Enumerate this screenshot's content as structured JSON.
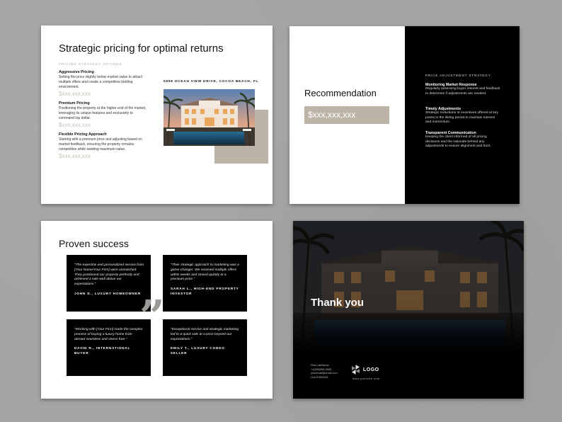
{
  "slide1": {
    "title": "Strategic pricing for optimal returns",
    "label": "PRICING STRATEGY OPTIONS",
    "options": [
      {
        "heading": "Aggressive Pricing",
        "desc": "Setting the price slightly below market value to attract multiple offers and create a competitive bidding environment.",
        "price": "$xxx,xxx,xxx"
      },
      {
        "heading": "Premium Pricing",
        "desc": "Positioning the property at the higher end of the market, leveraging its unique features and exclusivity to command top dollar.",
        "price": "$xxx,xxx,xxx"
      },
      {
        "heading": "Flexible Pricing Approach",
        "desc": "Starting with a premium price and adjusting based on market feedback, ensuring the property remains competitive while seeking maximum value.",
        "price": "$xxx,xxx,xxx"
      }
    ],
    "address": "5898 OCEAN VIEW DRIVE, COCOA BEACH, FL"
  },
  "slide2": {
    "heading": "Recommendation",
    "price": "$xxx,xxx,xxx",
    "panel_label": "PRICE ADJUSTMENT STRATEGY",
    "strategies": [
      {
        "heading": "Monitoring Market Response",
        "desc": "Regularly assessing buyer interest and feedback to determine if adjustments are needed."
      },
      {
        "heading": "Timely Adjustments",
        "desc": "Strategic reductions or incentives offered at key points in the listing period to maintain interest and momentum."
      },
      {
        "heading": "Transparent Communication",
        "desc": "Keeping the client informed of all pricing decisions and the rationale behind any adjustments to ensure alignment and trust."
      }
    ]
  },
  "slide3": {
    "title": "Proven success",
    "testimonials": [
      {
        "quote": "\"The expertise and personalized service from [Your Name/Your Firm] were unmatched. They positioned our property perfectly and achieved a sale well above our expectations.\"",
        "author": "JOHN D., LUXURY HOMEOWNER"
      },
      {
        "quote": "\"Their strategic approach to marketing was a game-changer. We received multiple offers within weeks and closed quickly at a premium price.\"",
        "author": "SARAH L., HIGH-END PROPERTY INVESTOR"
      },
      {
        "quote": "\"Working with [Your Firm] made the complex process of buying a luxury home from abroad seamless and stress-free.\"",
        "author": "DAVID R., INTERNATIONAL BUYER"
      },
      {
        "quote": "\"Exceptional service and strategic marketing led to a quick sale at a price beyond our expectations.\"",
        "author": "EMILY T., LUXURY CONDO SELLER"
      }
    ],
    "quote_mark": "”"
  },
  "slide4": {
    "heading": "Thank you",
    "contact": [
      "First LastName",
      "+1(555)555.5555",
      "youremail@email.com",
      "Lic# 87654321"
    ],
    "logo": "LOGO",
    "website": "www.yoursite.com"
  },
  "colors": {
    "beige": "#bdb4a8",
    "price_text": "#c9bfb3",
    "background": "#a4a4a2",
    "dark_panel": "#000000"
  }
}
